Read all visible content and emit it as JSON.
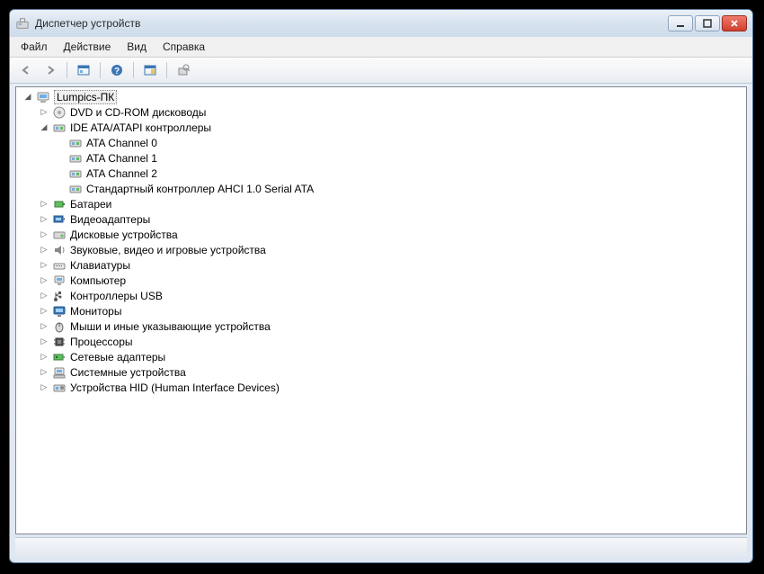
{
  "window": {
    "title": "Диспетчер устройств"
  },
  "menu": {
    "file": "Файл",
    "action": "Действие",
    "view": "Вид",
    "help": "Справка"
  },
  "tree": {
    "root": "Lumpics-ПК",
    "dvd": "DVD и CD-ROM дисководы",
    "ide": "IDE ATA/ATAPI контроллеры",
    "ide_children": {
      "c0": "ATA Channel 0",
      "c1": "ATA Channel 1",
      "c2": "ATA Channel 2",
      "ahci": "Стандартный контроллер AHCI 1.0 Serial ATA"
    },
    "battery": "Батареи",
    "display": "Видеоадаптеры",
    "disk": "Дисковые устройства",
    "sound": "Звуковые, видео и игровые устройства",
    "keyboard": "Клавиатуры",
    "computer": "Компьютер",
    "usb": "Контроллеры USB",
    "monitor": "Мониторы",
    "mouse": "Мыши и иные указывающие устройства",
    "cpu": "Процессоры",
    "network": "Сетевые адаптеры",
    "system": "Системные устройства",
    "hid": "Устройства HID (Human Interface Devices)"
  }
}
